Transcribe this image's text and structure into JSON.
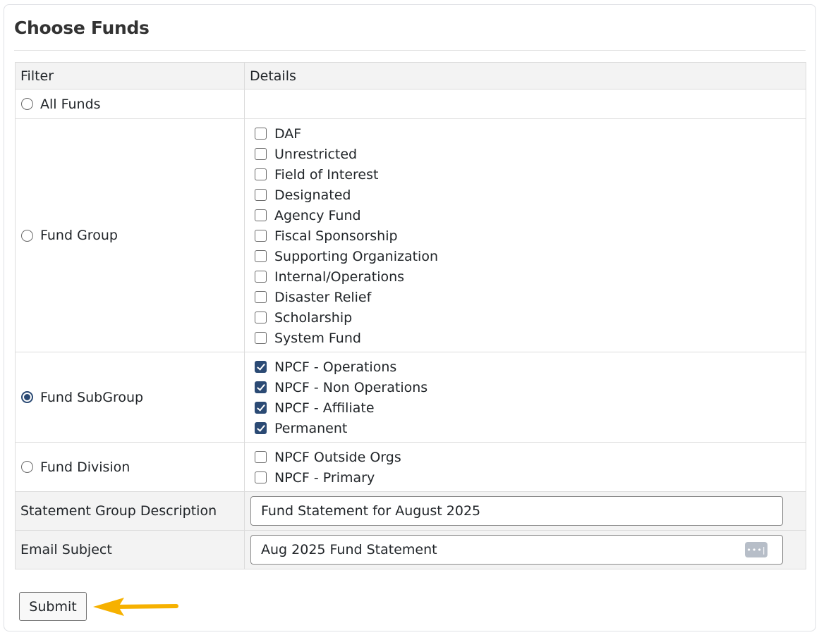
{
  "page": {
    "title": "Choose Funds"
  },
  "table": {
    "headers": {
      "filter": "Filter",
      "details": "Details"
    },
    "rows": {
      "all_funds": {
        "label": "All Funds",
        "selected": false
      },
      "fund_group": {
        "label": "Fund Group",
        "selected": false,
        "options": [
          {
            "label": "DAF",
            "checked": false
          },
          {
            "label": "Unrestricted",
            "checked": false
          },
          {
            "label": "Field of Interest",
            "checked": false
          },
          {
            "label": "Designated",
            "checked": false
          },
          {
            "label": "Agency Fund",
            "checked": false
          },
          {
            "label": "Fiscal Sponsorship",
            "checked": false
          },
          {
            "label": "Supporting Organization",
            "checked": false
          },
          {
            "label": "Internal/Operations",
            "checked": false
          },
          {
            "label": "Disaster Relief",
            "checked": false
          },
          {
            "label": "Scholarship",
            "checked": false
          },
          {
            "label": "System Fund",
            "checked": false
          }
        ]
      },
      "fund_subgroup": {
        "label": "Fund SubGroup",
        "selected": true,
        "options": [
          {
            "label": "NPCF - Operations",
            "checked": true
          },
          {
            "label": "NPCF - Non Operations",
            "checked": true
          },
          {
            "label": "NPCF - Affiliate",
            "checked": true
          },
          {
            "label": "Permanent",
            "checked": true
          }
        ]
      },
      "fund_division": {
        "label": "Fund Division",
        "selected": false,
        "options": [
          {
            "label": "NPCF Outside Orgs",
            "checked": false
          },
          {
            "label": "NPCF - Primary",
            "checked": false
          }
        ]
      },
      "statement_group": {
        "label": "Statement Group Description",
        "value": "Fund Statement for August 2025"
      },
      "email_subject": {
        "label": "Email Subject",
        "value": "Aug 2025 Fund Statement",
        "icon": "password-manager-icon"
      }
    }
  },
  "actions": {
    "submit_label": "Submit"
  },
  "annotation": {
    "icon": "arrow-left-icon",
    "color": "#f6b100"
  },
  "colors": {
    "accent": "#2b4a74",
    "header_bg": "#f3f3f3",
    "border": "#dcdcdc"
  }
}
